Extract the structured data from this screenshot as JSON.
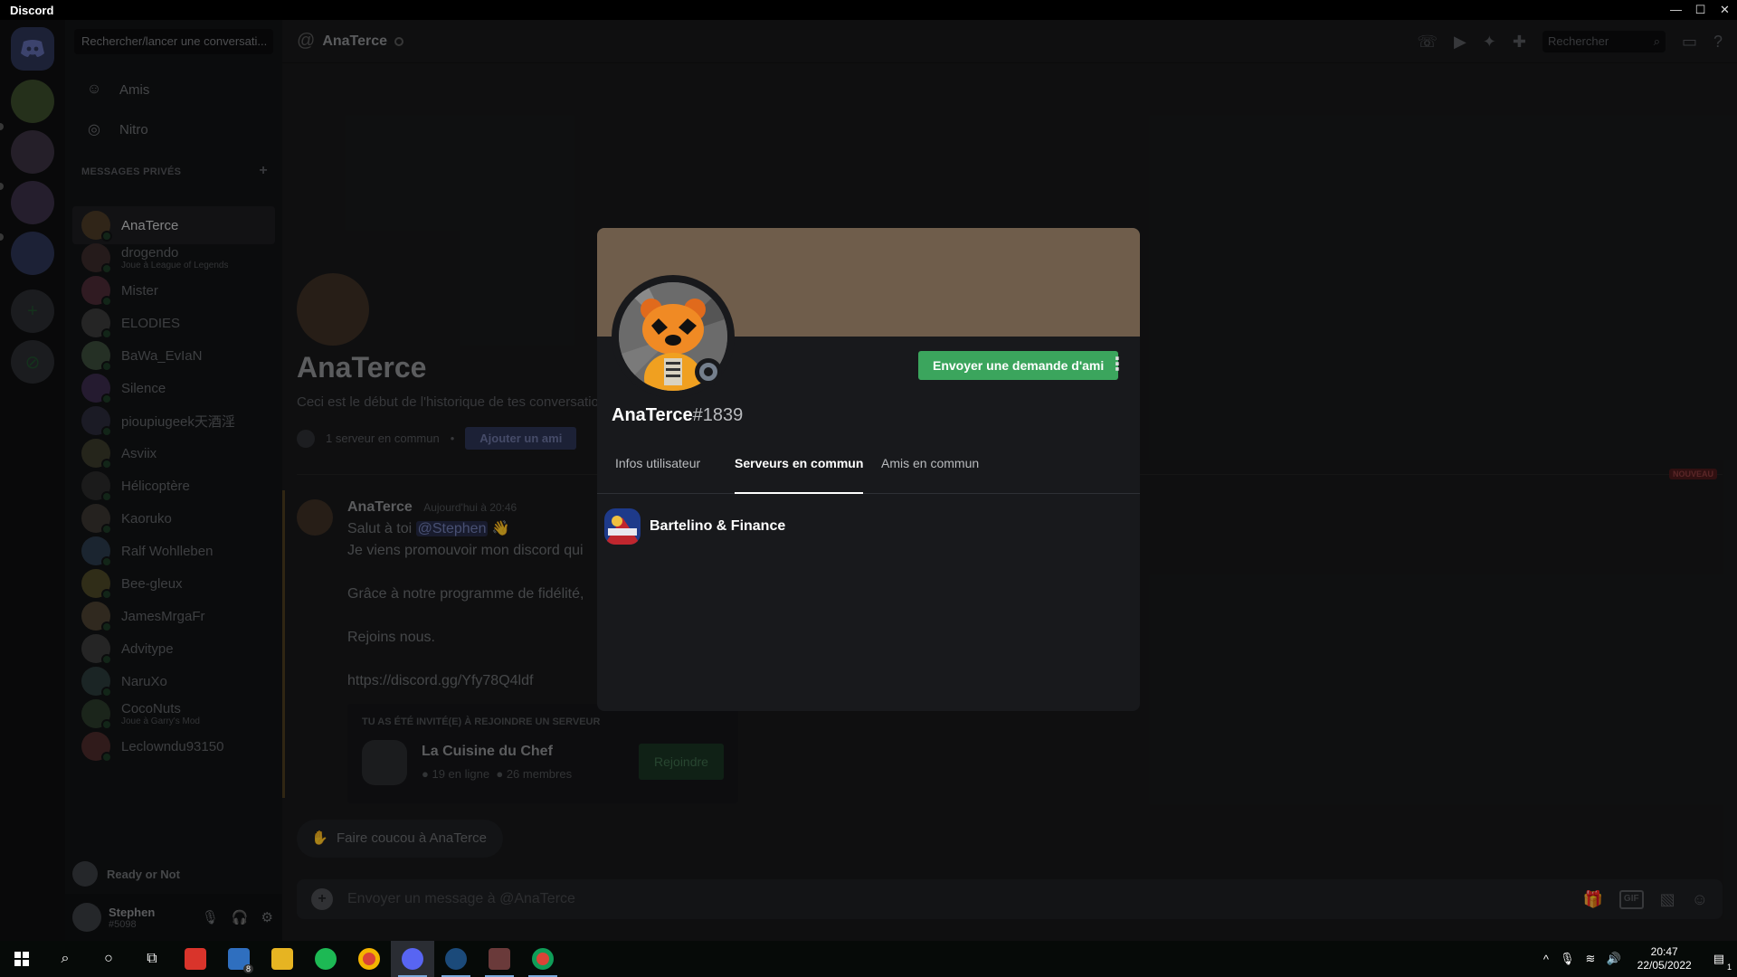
{
  "window": {
    "title": "Discord",
    "controls": [
      "—",
      "☐",
      "✕"
    ]
  },
  "dm_sidebar": {
    "search_placeholder": "Rechercher/lancer une conversati...",
    "nav": [
      {
        "label": "Amis",
        "icon": "friends-icon"
      },
      {
        "label": "Nitro",
        "icon": "nitro-icon"
      }
    ],
    "section_title": "MESSAGES PRIVÉS",
    "add_symbol": "+",
    "items": [
      {
        "name": "AnaTerce",
        "status": ""
      },
      {
        "name": "drogendo",
        "status": "Joue à League of Legends"
      },
      {
        "name": "Mister",
        "status": ""
      },
      {
        "name": "ELODIES",
        "status": ""
      },
      {
        "name": "BaWa_EvIaN",
        "status": ""
      },
      {
        "name": "Silence",
        "status": ""
      },
      {
        "name": "pioupiugeek天酒淫",
        "status": ""
      },
      {
        "name": "Asviix",
        "status": ""
      },
      {
        "name": "Hélicoptère",
        "status": ""
      },
      {
        "name": "Kaoruko",
        "status": ""
      },
      {
        "name": "Ralf Wohlleben",
        "status": ""
      },
      {
        "name": "Bee-gleux",
        "status": ""
      },
      {
        "name": "JamesMrgaFr",
        "status": ""
      },
      {
        "name": "Advitype",
        "status": ""
      },
      {
        "name": "NaruXo",
        "status": ""
      },
      {
        "name": "CocoNuts",
        "status": "Joue à Garry's Mod"
      },
      {
        "name": "Leclowndu93150",
        "status": ""
      }
    ],
    "activity": "Ready or Not",
    "user": {
      "name": "Stephen",
      "tag": "#5098"
    }
  },
  "header": {
    "channel": "AnaTerce",
    "search_placeholder": "Rechercher"
  },
  "welcome": {
    "title": "AnaTerce",
    "subtitle": "Ceci est le début de l'historique de tes conversatio",
    "mutual": "1 serveur en commun",
    "add_friend": "Ajouter un ami",
    "new_badge": "NOUVEAU"
  },
  "message": {
    "author": "AnaTerce",
    "time": "Aujourd'hui à 20:46",
    "line1_prefix": "Salut à toi",
    "mention": "@Stephen",
    "emoji": "👋",
    "line2": "Je viens promouvoir mon discord qui",
    "line3": "Grâce à notre programme de fidélité,",
    "line4": "Rejoins nous.",
    "link": "https://discord.gg/Yfy78Q4ldf"
  },
  "invite": {
    "label": "TU AS ÉTÉ INVITÉ(E) À REJOINDRE UN SERVEUR",
    "server": "La Cuisine du Chef",
    "online": "19 en ligne",
    "members": "26 membres",
    "join": "Rejoindre"
  },
  "wave_button": "Faire coucou à AnaTerce",
  "composer": {
    "placeholder": "Envoyer un message à @AnaTerce",
    "gif": "GIF"
  },
  "profile": {
    "username": "AnaTerce",
    "discriminator": "#1839",
    "friend_request": "Envoyer une demande d'ami",
    "more": "⋮",
    "tabs": [
      "Infos utilisateur",
      "Serveurs en commun",
      "Amis en commun"
    ],
    "active_tab": 1,
    "servers": [
      "Bartelino & Finance"
    ],
    "banner_color": "#6f5d4b"
  },
  "taskbar": {
    "time": "20:47",
    "date": "22/05/2022",
    "mail_badge": "8",
    "notif_badge": "1"
  }
}
